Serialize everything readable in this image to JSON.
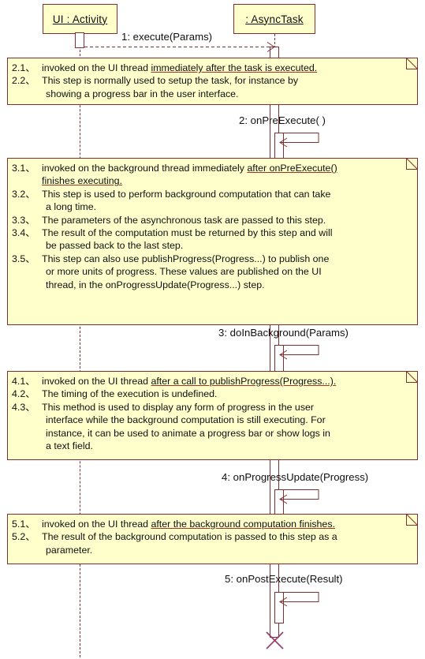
{
  "diagram": {
    "title": "AsyncTask UML sequence diagram",
    "colors": {
      "note_fill": "#ffffcc",
      "border": "#803030",
      "underline": "#b03020",
      "background": "#ffffff",
      "text": "#101010"
    }
  },
  "lifelines": [
    {
      "id": "activity",
      "label": "UI : Activity"
    },
    {
      "id": "asynctask",
      "label": ": AsyncTask"
    }
  ],
  "messages": [
    {
      "id": "m1",
      "label": "1: execute(Params)"
    },
    {
      "id": "m2",
      "label": "2: onPreExecute( )"
    },
    {
      "id": "m3",
      "label": "3: doInBackground(Params)"
    },
    {
      "id": "m4",
      "label": "4: onProgressUpdate(Progress)"
    },
    {
      "id": "m5",
      "label": "5: onPostExecute(Result)"
    }
  ],
  "notes": [
    {
      "id": "note2",
      "lines": [
        {
          "num": "2.1、",
          "text": "invoked on the UI thread ",
          "underlined": "immediately after the task is executed."
        },
        {
          "num": "2.2、",
          "text": "This step is normally used to setup the task, for instance by",
          "underlined": ""
        }
      ],
      "continuations": [
        "showing a progress bar in the user interface."
      ]
    },
    {
      "id": "note3",
      "lines": [
        {
          "num": "3.1、",
          "text": "invoked on the background thread immediately ",
          "underlined": "after onPreExecute()"
        },
        {
          "num": "",
          "text": "",
          "underlined": "finishes executing."
        },
        {
          "num": "3.2、",
          "text": "This step is used to perform background computation that can  take",
          "underlined": ""
        },
        {
          "num": "",
          "text": "a long time.",
          "underlined": ""
        },
        {
          "num": "3.3、",
          "text": "The parameters of the asynchronous task are passed to this step.",
          "underlined": ""
        },
        {
          "num": "3.4、",
          "text": "The result of the computation must be returned by this step and will",
          "underlined": ""
        },
        {
          "num": "",
          "text": "be passed back to the last step.",
          "underlined": ""
        },
        {
          "num": "3.5、",
          "text": "This step can also use publishProgress(Progress...) to publish one",
          "underlined": ""
        },
        {
          "num": "",
          "text": "or more units of progress. These values are published on  the UI",
          "underlined": ""
        },
        {
          "num": "",
          "text": "thread, in the onProgressUpdate(Progress...) step.",
          "underlined": ""
        }
      ],
      "continuations": []
    },
    {
      "id": "note4",
      "lines": [
        {
          "num": "4.1、",
          "text": "invoked on the UI thread ",
          "underlined": "after a call to publishProgress(Progress...)."
        },
        {
          "num": "4.2、",
          "text": "The timing of the execution is undefined.",
          "underlined": ""
        },
        {
          "num": "4.3、",
          "text": "This method is used to display any form of progress in the user",
          "underlined": ""
        },
        {
          "num": "",
          "text": "interface while the background computation is still executing. For",
          "underlined": ""
        },
        {
          "num": "",
          "text": "instance, it can be used to animate a progress bar or show logs in",
          "underlined": ""
        },
        {
          "num": "",
          "text": "a text field.",
          "underlined": ""
        }
      ],
      "continuations": []
    },
    {
      "id": "note5",
      "lines": [
        {
          "num": "5.1、",
          "text": "invoked on the UI thread ",
          "underlined": "after the background computation finishes."
        },
        {
          "num": "5.2、",
          "text": "The result of the background computation is passed to this step as a",
          "underlined": ""
        },
        {
          "num": "",
          "text": "parameter.",
          "underlined": ""
        }
      ],
      "continuations": []
    }
  ],
  "markers": {
    "destruction": "destruction-x-marker"
  }
}
